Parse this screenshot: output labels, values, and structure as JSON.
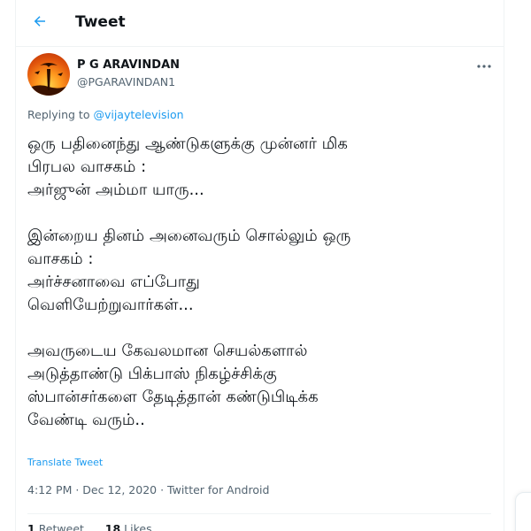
{
  "header": {
    "title": "Tweet"
  },
  "author": {
    "name": "P G ARAVINDAN",
    "handle": "@PGARAVINDAN1"
  },
  "replying": {
    "prefix": "Replying to ",
    "mention": "@vijaytelevision"
  },
  "tweet": {
    "lines": [
      "ஒரு பதினைந்து ஆண்டுகளுக்கு முன்னர் மிக",
      "பிரபல வாசகம் :",
      "அர்ஜுன் அம்மா யாரு...",
      "",
      "இன்றைய தினம் அனைவரும் சொல்லும் ஒரு",
      "வாசகம் :",
      "அர்ச்சனாவை எப்போது",
      "வெளியேற்றுவார்கள்...",
      "",
      "அவருடைய கேவலமான செயல்களால்",
      "அடுத்தாண்டு பிக்பாஸ் நிகழ்ச்சிக்கு",
      "ஸ்பான்சர்களை தேடித்தான் கண்டுபிடிக்க",
      "வேண்டி வரும்.."
    ]
  },
  "translate_label": "Translate Tweet",
  "meta": {
    "text": "4:12 PM · Dec 12, 2020 · Twitter for Android"
  },
  "stats": {
    "retweets_count": "1",
    "retweets_label": "Retweet",
    "likes_count": "18",
    "likes_label": "Likes"
  },
  "colors": {
    "link": "#1d9bf0",
    "secondary": "#536471",
    "text": "#0f1419"
  },
  "icons": {
    "back": "arrow-left-icon",
    "more": "more-dots-icon"
  }
}
